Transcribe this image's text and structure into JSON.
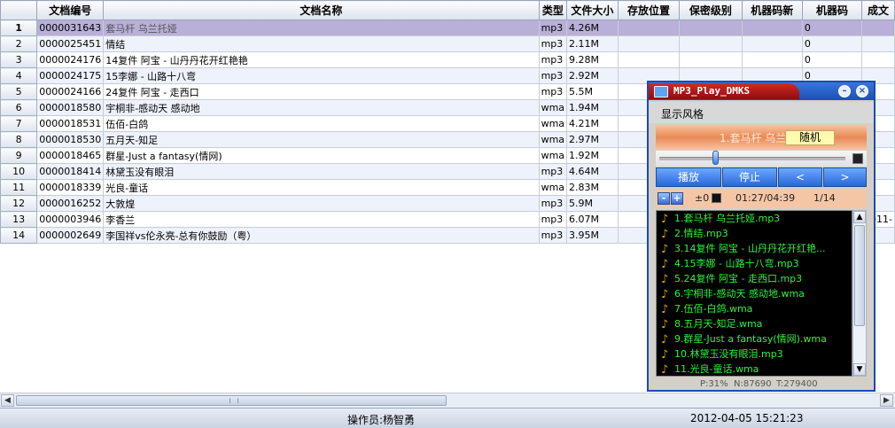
{
  "columns": [
    "文档编号",
    "文档名称",
    "类型",
    "文件大小",
    "存放位置",
    "保密级别",
    "机器码新",
    "机器码",
    "成文"
  ],
  "rows": [
    {
      "n": "1",
      "id": "0000031643",
      "name": "套马杆 乌兰托娅",
      "type": "mp3",
      "size": "4.26M",
      "loc": "",
      "sec": "",
      "newcode": "",
      "code": "0",
      "extra": ""
    },
    {
      "n": "2",
      "id": "0000025451",
      "name": "情结",
      "type": "mp3",
      "size": "2.11M",
      "loc": "",
      "sec": "",
      "newcode": "",
      "code": "0",
      "extra": ""
    },
    {
      "n": "3",
      "id": "0000024176",
      "name": "14复件 阿宝 - 山丹丹花开红艳艳",
      "type": "mp3",
      "size": "9.28M",
      "loc": "",
      "sec": "",
      "newcode": "",
      "code": "0",
      "extra": ""
    },
    {
      "n": "4",
      "id": "0000024175",
      "name": "15李娜 - 山路十八弯",
      "type": "mp3",
      "size": "2.92M",
      "loc": "",
      "sec": "",
      "newcode": "",
      "code": "0",
      "extra": ""
    },
    {
      "n": "5",
      "id": "0000024166",
      "name": "24复件 阿宝 - 走西口",
      "type": "mp3",
      "size": "5.5M",
      "loc": "",
      "sec": "",
      "newcode": "",
      "code": "",
      "extra": ""
    },
    {
      "n": "6",
      "id": "0000018580",
      "name": "宇桐非-感动天 感动地",
      "type": "wma",
      "size": "1.94M",
      "loc": "",
      "sec": "",
      "newcode": "",
      "code": "",
      "extra": ""
    },
    {
      "n": "7",
      "id": "0000018531",
      "name": "伍佰-白鸽",
      "type": "wma",
      "size": "4.21M",
      "loc": "",
      "sec": "",
      "newcode": "",
      "code": "",
      "extra": ""
    },
    {
      "n": "8",
      "id": "0000018530",
      "name": "五月天-知足",
      "type": "wma",
      "size": "2.97M",
      "loc": "",
      "sec": "",
      "newcode": "",
      "code": "",
      "extra": ""
    },
    {
      "n": "9",
      "id": "0000018465",
      "name": "群星-Just a fantasy(情网)",
      "type": "wma",
      "size": "1.92M",
      "loc": "",
      "sec": "",
      "newcode": "",
      "code": "",
      "extra": ""
    },
    {
      "n": "10",
      "id": "0000018414",
      "name": "林黛玉没有眼泪",
      "type": "mp3",
      "size": "4.64M",
      "loc": "",
      "sec": "",
      "newcode": "",
      "code": "",
      "extra": ""
    },
    {
      "n": "11",
      "id": "0000018339",
      "name": "光良-童话",
      "type": "wma",
      "size": "2.83M",
      "loc": "",
      "sec": "",
      "newcode": "",
      "code": "",
      "extra": ""
    },
    {
      "n": "12",
      "id": "0000016252",
      "name": "大敦煌",
      "type": "mp3",
      "size": "5.9M",
      "loc": "",
      "sec": "",
      "newcode": "",
      "code": "",
      "extra": ""
    },
    {
      "n": "13",
      "id": "0000003946",
      "name": "李香兰",
      "type": "mp3",
      "size": "6.07M",
      "loc": "",
      "sec": "",
      "newcode": "",
      "code": "",
      "extra": "2011-"
    },
    {
      "n": "14",
      "id": "0000002649",
      "name": "李国祥vs伦永亮-总有你鼓励（粤）",
      "type": "mp3",
      "size": "3.95M",
      "loc": "",
      "sec": "",
      "newcode": "",
      "code": "",
      "extra": ""
    }
  ],
  "status": {
    "operator": "操作员:杨智勇",
    "datetime": "2012-04-05  15:21:23"
  },
  "player": {
    "title": "MP3_Play_DMKS",
    "menu_label": "显示风格",
    "now_playing": "1.套马杆 乌兰托",
    "mode_label": "随机",
    "play_label": "播放",
    "stop_label": "停止",
    "prev_label": "<",
    "next_label": ">",
    "minus_label": "-",
    "plus_label": "+",
    "volume": "±0",
    "time": "01:27/04:39",
    "track": "1/14",
    "seek_position": 0.31,
    "playlist": [
      "1.套马杆 乌兰托娅.mp3",
      "2.情结.mp3",
      "3.14复件 阿宝 - 山丹丹花开红艳...",
      "4.15李娜 - 山路十八弯.mp3",
      "5.24复件 阿宝 - 走西口.mp3",
      "6.宇桐非-感动天 感动地.wma",
      "7.伍佰-白鸽.wma",
      "8.五月天-知足.wma",
      "9.群星-Just a fantasy(情网).wma",
      "10.林黛玉没有眼泪.mp3",
      "11.光良-童话.wma"
    ],
    "stats": {
      "p": "P:31%",
      "n": "N:87690",
      "t": "T:279400"
    }
  },
  "icons": {
    "scroll_left": "◀",
    "scroll_right": "▶",
    "scroll_up": "▲",
    "scroll_down": "▼"
  }
}
